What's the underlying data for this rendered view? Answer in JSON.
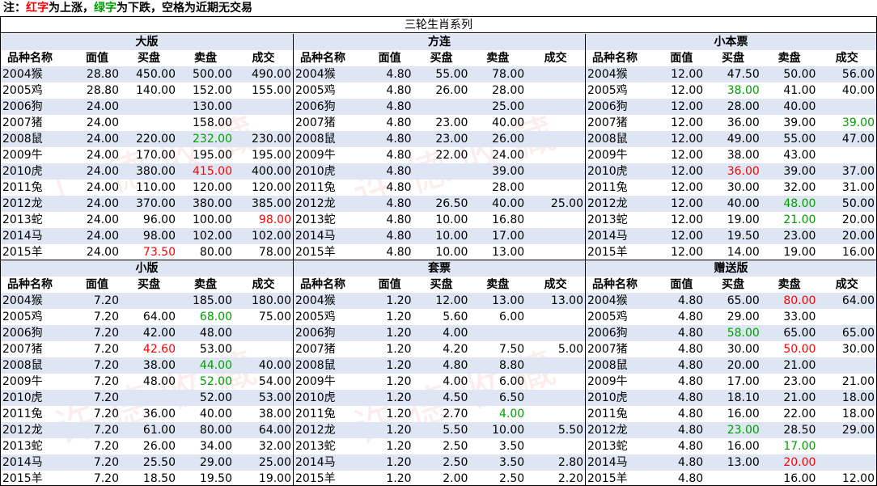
{
  "note": {
    "prefix": "注：",
    "red_word": "红字",
    "red_text": "为上涨，",
    "green_word": "绿字",
    "green_text": "为下跌，空格为近期无交易"
  },
  "title": "三轮生肖系列",
  "headers": [
    "品种名称",
    "面值",
    "买盘",
    "卖盘",
    "成交"
  ],
  "colors": {
    "up": "#ff0000",
    "down": "#00a000",
    "stripe": "#dde6f2"
  },
  "panels": [
    {
      "title": "大版",
      "rows": [
        {
          "name": "2004猴",
          "face": "28.80",
          "bid": "450.00",
          "ask": "500.00",
          "deal": "490.00"
        },
        {
          "name": "2005鸡",
          "face": "28.80",
          "bid": "140.00",
          "ask": "152.00",
          "deal": "155.00"
        },
        {
          "name": "2006狗",
          "face": "24.00",
          "bid": "",
          "ask": "130.00",
          "deal": ""
        },
        {
          "name": "2007猪",
          "face": "24.00",
          "bid": "",
          "ask": "158.00",
          "deal": ""
        },
        {
          "name": "2008鼠",
          "face": "24.00",
          "bid": "220.00",
          "ask": "232.00",
          "ask_c": "down",
          "deal": "230.00"
        },
        {
          "name": "2009牛",
          "face": "24.00",
          "bid": "170.00",
          "ask": "195.00",
          "deal": "195.00"
        },
        {
          "name": "2010虎",
          "face": "24.00",
          "bid": "380.00",
          "ask": "415.00",
          "ask_c": "up",
          "deal": "400.00"
        },
        {
          "name": "2011兔",
          "face": "24.00",
          "bid": "110.00",
          "ask": "120.00",
          "deal": "120.00"
        },
        {
          "name": "2012龙",
          "face": "24.00",
          "bid": "370.00",
          "ask": "380.00",
          "deal": "385.00"
        },
        {
          "name": "2013蛇",
          "face": "24.00",
          "bid": "96.00",
          "ask": "100.00",
          "deal": "98.00",
          "deal_c": "up"
        },
        {
          "name": "2014马",
          "face": "24.00",
          "bid": "98.00",
          "ask": "102.00",
          "deal": "102.00"
        },
        {
          "name": "2015羊",
          "face": "24.00",
          "bid": "73.50",
          "bid_c": "up",
          "ask": "80.00",
          "deal": "78.00"
        }
      ]
    },
    {
      "title": "方连",
      "rows": [
        {
          "name": "2004猴",
          "face": "4.80",
          "bid": "55.00",
          "ask": "78.00",
          "deal": ""
        },
        {
          "name": "2005鸡",
          "face": "4.80",
          "bid": "26.00",
          "ask": "28.00",
          "deal": ""
        },
        {
          "name": "2006狗",
          "face": "4.80",
          "bid": "",
          "ask": "25.00",
          "deal": ""
        },
        {
          "name": "2007猪",
          "face": "4.80",
          "bid": "23.00",
          "ask": "40.00",
          "deal": ""
        },
        {
          "name": "2008鼠",
          "face": "4.80",
          "bid": "23.00",
          "ask": "26.00",
          "deal": ""
        },
        {
          "name": "2009牛",
          "face": "4.80",
          "bid": "22.00",
          "ask": "24.00",
          "deal": ""
        },
        {
          "name": "2010虎",
          "face": "4.80",
          "bid": "",
          "ask": "39.00",
          "deal": ""
        },
        {
          "name": "2011兔",
          "face": "4.80",
          "bid": "",
          "ask": "28.00",
          "deal": ""
        },
        {
          "name": "2012龙",
          "face": "4.80",
          "bid": "26.50",
          "ask": "40.00",
          "deal": "25.00"
        },
        {
          "name": "2013蛇",
          "face": "4.80",
          "bid": "10.00",
          "ask": "16.80",
          "deal": ""
        },
        {
          "name": "2014马",
          "face": "4.80",
          "bid": "10.00",
          "ask": "17.00",
          "deal": ""
        },
        {
          "name": "2015羊",
          "face": "4.80",
          "bid": "10.00",
          "ask": "13.00",
          "deal": ""
        }
      ]
    },
    {
      "title": "小本票",
      "rows": [
        {
          "name": "2004猴",
          "face": "12.00",
          "bid": "47.50",
          "ask": "50.00",
          "deal": "56.00"
        },
        {
          "name": "2005鸡",
          "face": "12.00",
          "bid": "38.00",
          "bid_c": "down",
          "ask": "41.00",
          "deal": "40.00"
        },
        {
          "name": "2006狗",
          "face": "12.00",
          "bid": "28.00",
          "ask": "40.00",
          "deal": ""
        },
        {
          "name": "2007猪",
          "face": "12.00",
          "bid": "36.00",
          "ask": "39.00",
          "deal": "39.00",
          "deal_c": "down"
        },
        {
          "name": "2008鼠",
          "face": "12.00",
          "bid": "49.00",
          "ask": "55.00",
          "deal": "47.00"
        },
        {
          "name": "2009牛",
          "face": "12.00",
          "bid": "38.00",
          "ask": "43.00",
          "deal": ""
        },
        {
          "name": "2010虎",
          "face": "12.00",
          "bid": "36.00",
          "bid_c": "up",
          "ask": "39.00",
          "deal": "37.00"
        },
        {
          "name": "2011兔",
          "face": "12.00",
          "bid": "30.00",
          "ask": "32.00",
          "deal": "31.00"
        },
        {
          "name": "2012龙",
          "face": "12.00",
          "bid": "40.00",
          "ask": "48.00",
          "ask_c": "down",
          "deal": "50.00"
        },
        {
          "name": "2013蛇",
          "face": "12.00",
          "bid": "19.00",
          "ask": "21.00",
          "ask_c": "down",
          "deal": "20.00"
        },
        {
          "name": "2014马",
          "face": "12.00",
          "bid": "19.50",
          "ask": "23.00",
          "deal": "20.00"
        },
        {
          "name": "2015羊",
          "face": "12.00",
          "bid": "14.00",
          "ask": "19.00",
          "deal": "16.00"
        }
      ]
    },
    {
      "title": "小版",
      "rows": [
        {
          "name": "2004猴",
          "face": "7.20",
          "bid": "",
          "ask": "185.00",
          "deal": "180.00"
        },
        {
          "name": "2005鸡",
          "face": "7.20",
          "bid": "64.00",
          "ask": "68.00",
          "ask_c": "down",
          "deal": "75.00"
        },
        {
          "name": "2006狗",
          "face": "7.20",
          "bid": "42.00",
          "ask": "48.00",
          "deal": ""
        },
        {
          "name": "2007猪",
          "face": "7.20",
          "bid": "42.60",
          "bid_c": "up",
          "ask": "53.00",
          "deal": ""
        },
        {
          "name": "2008鼠",
          "face": "7.20",
          "bid": "38.00",
          "ask": "44.00",
          "ask_c": "down",
          "deal": "40.00"
        },
        {
          "name": "2009牛",
          "face": "7.20",
          "bid": "48.00",
          "ask": "52.00",
          "ask_c": "down",
          "deal": "54.00"
        },
        {
          "name": "2010虎",
          "face": "7.20",
          "bid": "",
          "ask": "52.00",
          "deal": "53.00"
        },
        {
          "name": "2011兔",
          "face": "7.20",
          "bid": "36.00",
          "ask": "40.00",
          "deal": "38.00"
        },
        {
          "name": "2012龙",
          "face": "7.20",
          "bid": "61.00",
          "ask": "80.00",
          "deal": "64.00"
        },
        {
          "name": "2013蛇",
          "face": "7.20",
          "bid": "26.00",
          "ask": "34.00",
          "deal": "32.00"
        },
        {
          "name": "2014马",
          "face": "7.20",
          "bid": "25.50",
          "ask": "29.00",
          "deal": "25.00"
        },
        {
          "name": "2015羊",
          "face": "7.20",
          "bid": "18.50",
          "ask": "19.50",
          "deal": "19.00"
        }
      ]
    },
    {
      "title": "套票",
      "rows": [
        {
          "name": "2004猴",
          "face": "1.20",
          "bid": "12.00",
          "ask": "13.00",
          "deal": "13.00"
        },
        {
          "name": "2005鸡",
          "face": "1.20",
          "bid": "5.60",
          "ask": "6.00",
          "deal": ""
        },
        {
          "name": "2006狗",
          "face": "1.20",
          "bid": "4.00",
          "ask": "",
          "deal": ""
        },
        {
          "name": "2007猪",
          "face": "1.20",
          "bid": "4.20",
          "ask": "7.50",
          "deal": "5.00"
        },
        {
          "name": "2008鼠",
          "face": "1.20",
          "bid": "4.80",
          "ask": "8.80",
          "deal": ""
        },
        {
          "name": "2009牛",
          "face": "1.20",
          "bid": "4.00",
          "ask": "6.00",
          "deal": ""
        },
        {
          "name": "2010虎",
          "face": "1.20",
          "bid": "4.50",
          "ask": "6.50",
          "deal": ""
        },
        {
          "name": "2011兔",
          "face": "1.20",
          "bid": "2.70",
          "ask": "4.00",
          "ask_c": "down",
          "deal": ""
        },
        {
          "name": "2012龙",
          "face": "1.20",
          "bid": "5.50",
          "ask": "10.00",
          "deal": "5.50"
        },
        {
          "name": "2013蛇",
          "face": "1.20",
          "bid": "2.50",
          "ask": "3.50",
          "deal": ""
        },
        {
          "name": "2014马",
          "face": "1.20",
          "bid": "2.50",
          "ask": "3.50",
          "deal": "2.80"
        },
        {
          "name": "2015羊",
          "face": "1.20",
          "bid": "2.00",
          "ask": "2.50",
          "deal": "2.20"
        }
      ]
    },
    {
      "title": "赠送版",
      "rows": [
        {
          "name": "2004猴",
          "face": "4.80",
          "bid": "65.00",
          "ask": "80.00",
          "ask_c": "up",
          "deal": "64.00"
        },
        {
          "name": "2005鸡",
          "face": "4.80",
          "bid": "29.00",
          "ask": "33.00",
          "deal": ""
        },
        {
          "name": "2006狗",
          "face": "4.80",
          "bid": "58.00",
          "bid_c": "down",
          "ask": "65.00",
          "deal": "65.00"
        },
        {
          "name": "2007猪",
          "face": "4.80",
          "bid": "30.00",
          "ask": "50.00",
          "ask_c": "up",
          "deal": "30.00"
        },
        {
          "name": "2008鼠",
          "face": "4.80",
          "bid": "20.00",
          "ask": "21.00",
          "deal": ""
        },
        {
          "name": "2009牛",
          "face": "4.80",
          "bid": "17.00",
          "ask": "23.00",
          "deal": "21.00"
        },
        {
          "name": "2010虎",
          "face": "4.80",
          "bid": "18.10",
          "ask": "21.00",
          "deal": "18.00"
        },
        {
          "name": "2011兔",
          "face": "4.80",
          "bid": "16.00",
          "ask": "22.00",
          "deal": "18.00"
        },
        {
          "name": "2012龙",
          "face": "4.80",
          "bid": "23.00",
          "bid_c": "down",
          "ask": "28.50",
          "deal": "29.00"
        },
        {
          "name": "2013蛇",
          "face": "4.80",
          "bid": "16.00",
          "ask": "17.00",
          "ask_c": "down",
          "deal": ""
        },
        {
          "name": "2014马",
          "face": "4.80",
          "bid": "13.00",
          "ask": "20.00",
          "ask_c": "up",
          "deal": ""
        },
        {
          "name": "2015羊",
          "face": "4.80",
          "bid": "",
          "ask": "16.00",
          "deal": "12.00"
        }
      ]
    }
  ]
}
